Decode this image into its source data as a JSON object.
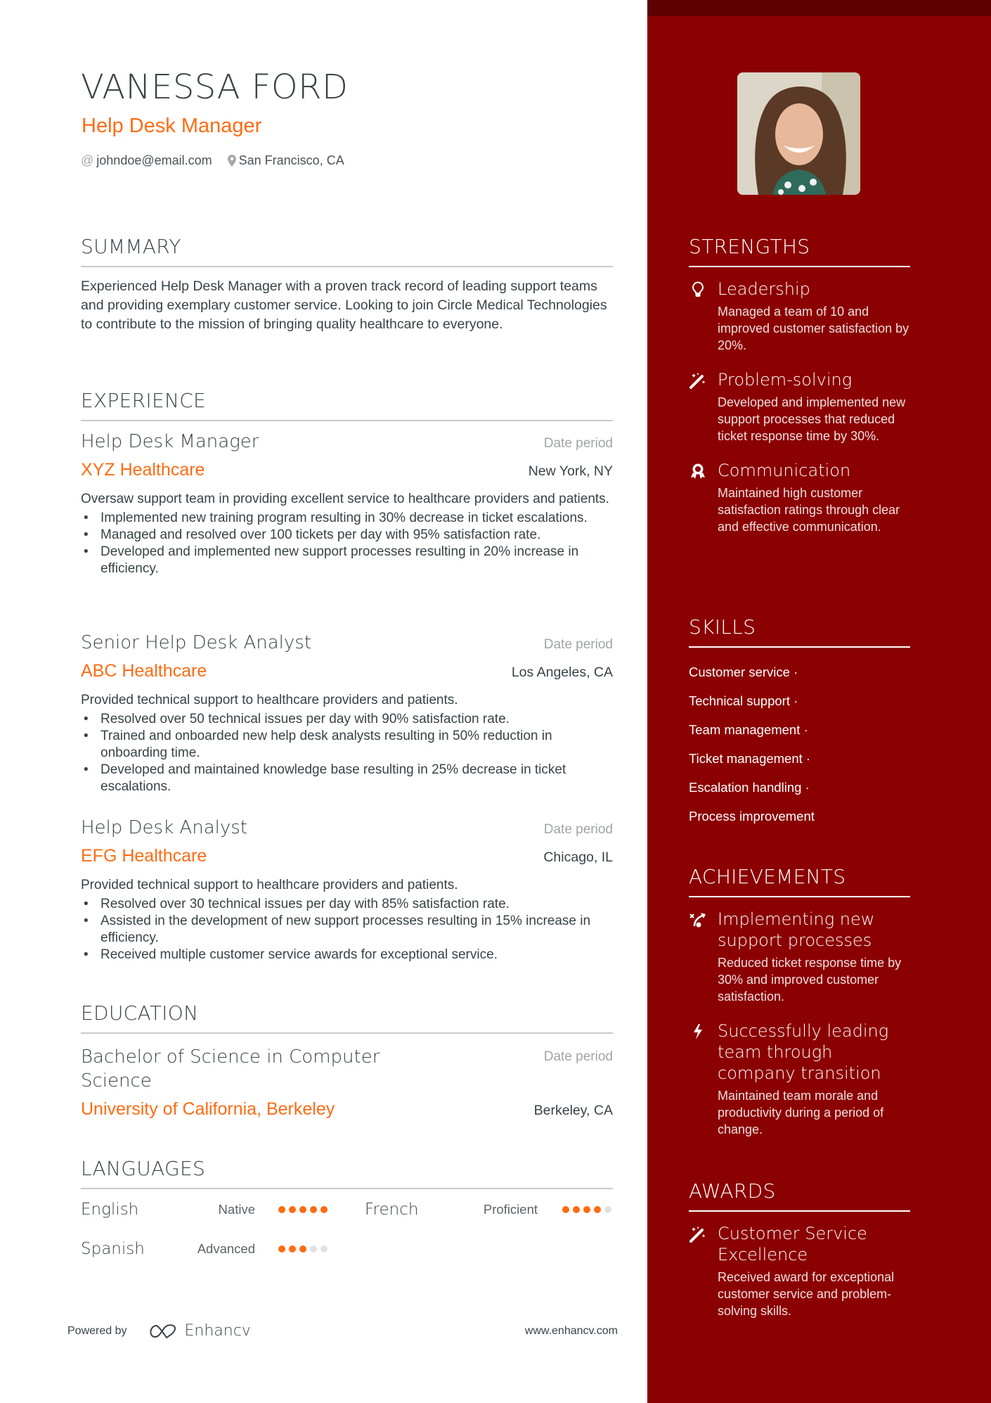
{
  "header": {
    "name": "VANESSA FORD",
    "title": "Help Desk Manager",
    "email": "johndoe@email.com",
    "location": "San Francisco, CA",
    "email_icon": "at-icon",
    "location_icon": "map-pin-icon"
  },
  "summary": {
    "heading": "SUMMARY",
    "text": "Experienced Help Desk Manager with a proven track record of leading support teams and providing exemplary customer service. Looking to join Circle Medical Technologies to contribute to the mission of bringing quality healthcare to everyone."
  },
  "experience": {
    "heading": "EXPERIENCE",
    "jobs": [
      {
        "role": "Help Desk Manager",
        "date": "Date period",
        "company": "XYZ Healthcare",
        "location": "New York, NY",
        "description": "Oversaw support team in providing excellent service to healthcare providers and patients.",
        "bullets": [
          "Implemented new training program resulting in 30% decrease in ticket escalations.",
          "Managed and resolved over 100 tickets per day with 95% satisfaction rate.",
          "Developed and implemented new support processes resulting in 20% increase in efficiency."
        ]
      },
      {
        "role": "Senior Help Desk Analyst",
        "date": "Date period",
        "company": "ABC Healthcare",
        "location": "Los Angeles, CA",
        "description": "Provided technical support to healthcare providers and patients.",
        "bullets": [
          "Resolved over 50 technical issues per day with 90% satisfaction rate.",
          "Trained and onboarded new help desk analysts resulting in 50% reduction in onboarding time.",
          "Developed and maintained knowledge base resulting in 25% decrease in ticket escalations."
        ]
      },
      {
        "role": "Help Desk Analyst",
        "date": "Date period",
        "company": "EFG Healthcare",
        "location": "Chicago, IL",
        "description": "Provided technical support to healthcare providers and patients.",
        "bullets": [
          "Resolved over 30 technical issues per day with 85% satisfaction rate.",
          "Assisted in the development of new support processes resulting in 15% increase in efficiency.",
          "Received multiple customer service awards for exceptional service."
        ]
      }
    ]
  },
  "education": {
    "heading": "EDUCATION",
    "degree": "Bachelor of Science in Computer Science",
    "date": "Date period",
    "school": "University of California, Berkeley",
    "location": "Berkeley, CA"
  },
  "languages": {
    "heading": "LANGUAGES",
    "items": [
      {
        "name": "English",
        "level": "Native",
        "rating": 5,
        "max": 5
      },
      {
        "name": "French",
        "level": "Proficient",
        "rating": 4,
        "max": 5
      },
      {
        "name": "Spanish",
        "level": "Advanced",
        "rating": 3,
        "max": 5
      }
    ]
  },
  "footer": {
    "powered_by": "Powered by",
    "brand": "Enhancv",
    "website": "www.enhancv.com"
  },
  "sidebar": {
    "photo_alt": "Profile photo of smiling woman",
    "strengths": {
      "heading": "STRENGTHS",
      "items": [
        {
          "icon": "lightbulb-icon",
          "title": "Leadership",
          "description": "Managed a team of 10 and improved customer satisfaction by 20%."
        },
        {
          "icon": "magic-wand-icon",
          "title": "Problem-solving",
          "description": "Developed and implemented new support processes that reduced ticket response time by 30%."
        },
        {
          "icon": "award-medal-icon",
          "title": "Communication",
          "description": "Maintained high customer satisfaction ratings through clear and effective communication."
        }
      ]
    },
    "skills": {
      "heading": "SKILLS",
      "items": [
        "Customer service ·",
        "Technical support ·",
        "Team management ·",
        "Ticket management ·",
        "Escalation handling ·",
        "Process improvement"
      ]
    },
    "achievements": {
      "heading": "ACHIEVEMENTS",
      "items": [
        {
          "icon": "strategy-path-icon",
          "title": "Implementing new support processes",
          "description": "Reduced ticket response time by 30% and improved customer satisfaction."
        },
        {
          "icon": "lightning-bolt-icon",
          "title": "Successfully leading team through company transition",
          "description": "Maintained team morale and productivity during a period of change."
        }
      ]
    },
    "awards": {
      "heading": "AWARDS",
      "items": [
        {
          "icon": "magic-wand-icon",
          "title": "Customer Service Excellence",
          "description": "Received award for exceptional customer service and problem-solving skills."
        }
      ]
    }
  },
  "colors": {
    "accent": "#ff6b12",
    "sidebar": "#8b0000",
    "sidebar_top": "#5c0000",
    "text": "#384347",
    "muted": "#a0a4a7"
  }
}
